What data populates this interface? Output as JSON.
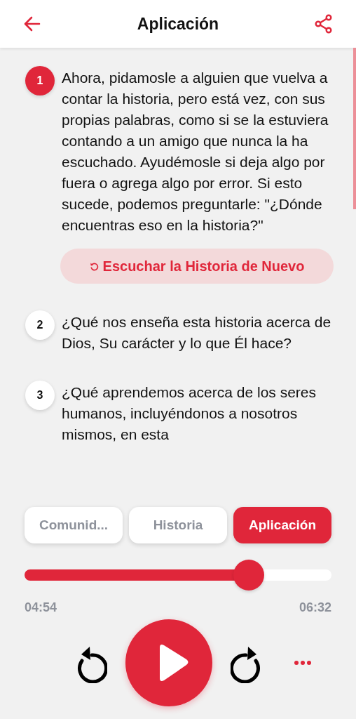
{
  "header": {
    "title": "Aplicación"
  },
  "questions": [
    {
      "number": "1",
      "selected": true,
      "text": "Ahora, pidamosle a alguien que vuelva a contar la historia, pero está vez, con sus propias palabras, como si se la estuviera contando a un amigo que nunca la ha escuchado. Ayudémosle si deja algo por fuera o agrega algo por error. Si esto sucede, podemos preguntarle: \"¿Dónde encuentras eso en la historia?\"",
      "action": "Escuchar la Historia de Nuevo"
    },
    {
      "number": "2",
      "selected": false,
      "text": "¿Qué nos enseña esta historia acerca de Dios, Su carácter y lo que Él hace?"
    },
    {
      "number": "3",
      "selected": false,
      "text": "¿Qué aprendemos acerca de los seres humanos, incluyéndonos a nosotros mismos, en esta"
    }
  ],
  "tabs": [
    {
      "label": "Comunid...",
      "selected": false
    },
    {
      "label": "Historia",
      "selected": false
    },
    {
      "label": "Aplicación",
      "selected": true
    }
  ],
  "player": {
    "level": 0.73,
    "elapsed": "04:54",
    "total": "06:32"
  }
}
